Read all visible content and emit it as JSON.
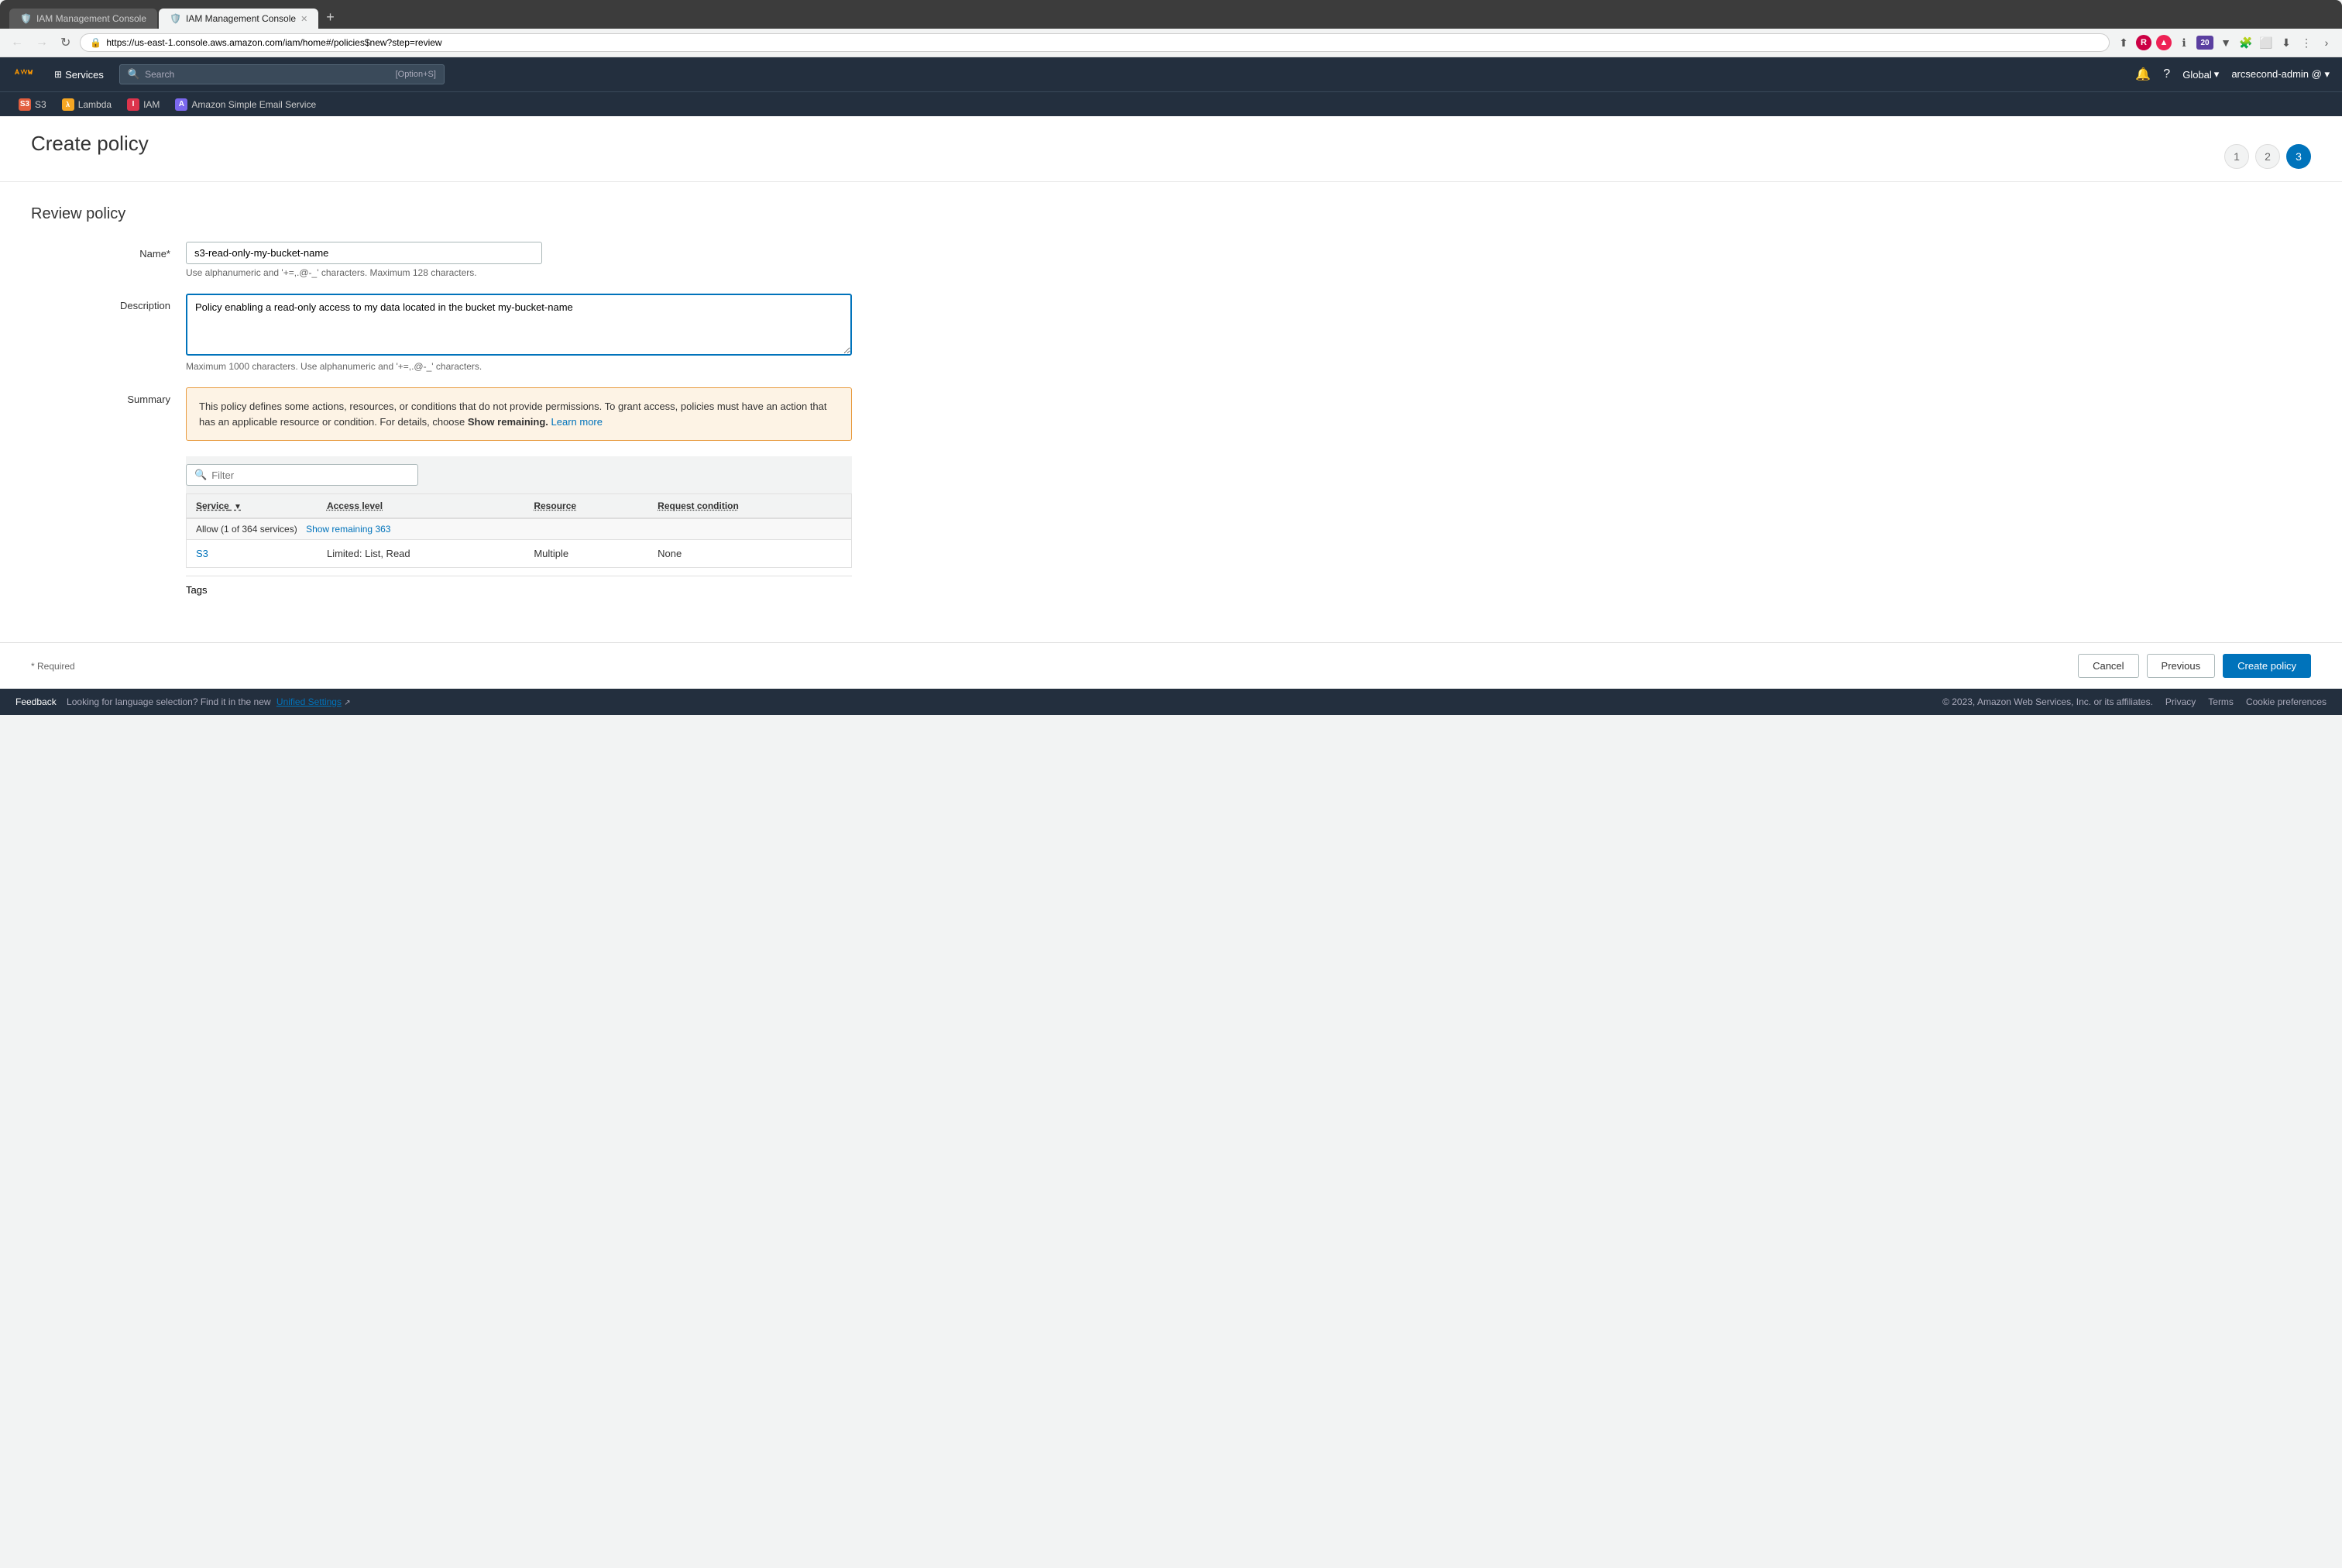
{
  "browser": {
    "tabs": [
      {
        "id": "tab1",
        "label": "IAM Management Console",
        "active": false,
        "icon": "🛡️"
      },
      {
        "id": "tab2",
        "label": "IAM Management Console",
        "active": true,
        "icon": "🛡️"
      }
    ],
    "url": "https://us-east-1.console.aws.amazon.com/iam/home#/policies$new?step=review",
    "new_tab_label": "+"
  },
  "nav": {
    "logo": "aws",
    "services_label": "Services",
    "search_placeholder": "Search",
    "search_shortcut": "[Option+S]",
    "region": "Global",
    "account": "arcsecond-admin @"
  },
  "bookmarks": [
    {
      "id": "s3",
      "label": "S3",
      "color": "#e25e3e"
    },
    {
      "id": "lambda",
      "label": "Lambda",
      "color": "#f5a623"
    },
    {
      "id": "iam",
      "label": "IAM",
      "color": "#dd344c"
    },
    {
      "id": "ses",
      "label": "Amazon Simple Email Service",
      "color": "#7b68ee"
    }
  ],
  "page": {
    "title": "Create policy",
    "steps": [
      {
        "number": "1",
        "active": false
      },
      {
        "number": "2",
        "active": false
      },
      {
        "number": "3",
        "active": true
      }
    ],
    "section_title": "Review policy"
  },
  "form": {
    "name_label": "Name*",
    "name_value": "s3-read-only-my-bucket-name",
    "name_hint": "Use alphanumeric and '+=,.@-_' characters. Maximum 128 characters.",
    "description_label": "Description",
    "description_value": "Policy enabling a read-only access to my data located in the bucket my-bucket-name",
    "description_hint": "Maximum 1000 characters. Use alphanumeric and '+=,.@-_' characters.",
    "summary_label": "Summary"
  },
  "warning": {
    "text": "This policy defines some actions, resources, or conditions that do not provide permissions. To grant access, policies must have an action that has an applicable resource or condition. For details, choose ",
    "bold_text": "Show remaining.",
    "link_text": "Learn more"
  },
  "table": {
    "filter_placeholder": "Filter",
    "columns": [
      {
        "id": "service",
        "label": "Service",
        "sortable": true
      },
      {
        "id": "access_level",
        "label": "Access level",
        "sortable": false
      },
      {
        "id": "resource",
        "label": "Resource",
        "sortable": false
      },
      {
        "id": "request_condition",
        "label": "Request condition",
        "sortable": false
      }
    ],
    "allow_row": {
      "label": "Allow (1 of 364 services)",
      "link_text": "Show remaining 363"
    },
    "rows": [
      {
        "service": "S3",
        "access_level": "Limited: List, Read",
        "resource": "Multiple",
        "request_condition": "None"
      }
    ]
  },
  "tags": {
    "label": "Tags"
  },
  "footer": {
    "required_label": "* Required",
    "cancel_label": "Cancel",
    "previous_label": "Previous",
    "create_label": "Create policy"
  },
  "bottom_bar": {
    "feedback_label": "Feedback",
    "settings_text": "Looking for language selection? Find it in the new",
    "settings_link": "Unified Settings",
    "copyright": "© 2023, Amazon Web Services, Inc. or its affiliates.",
    "privacy_label": "Privacy",
    "terms_label": "Terms",
    "cookie_label": "Cookie preferences"
  }
}
